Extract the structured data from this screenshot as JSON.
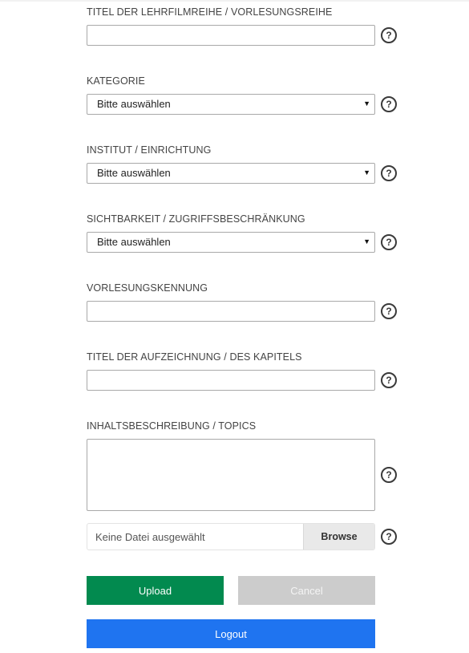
{
  "fields": {
    "series_title": {
      "label": "TITEL DER LEHRFILMREIHE / VORLESUNGSREIHE",
      "value": ""
    },
    "category": {
      "label": "KATEGORIE",
      "selected": "Bitte auswählen"
    },
    "institute": {
      "label": "INSTITUT / EINRICHTUNG",
      "selected": "Bitte auswählen"
    },
    "visibility": {
      "label": "SICHTBARKEIT / ZUGRIFFSBESCHRÄNKUNG",
      "selected": "Bitte auswählen"
    },
    "lecture_id": {
      "label": "VORLESUNGSKENNUNG",
      "value": ""
    },
    "recording_title": {
      "label": "TITEL DER AUFZEICHNUNG / DES KAPITELS",
      "value": ""
    },
    "description": {
      "label": "INHALTSBESCHREIBUNG / TOPICS",
      "value": ""
    }
  },
  "file": {
    "placeholder": "Keine Datei ausgewählt",
    "browse_label": "Browse"
  },
  "help_glyph": "?",
  "select_arrow": "▼",
  "buttons": {
    "upload": "Upload",
    "cancel": "Cancel",
    "logout": "Logout"
  },
  "colors": {
    "upload": "#028a4f",
    "cancel": "#cccccc",
    "logout": "#1f74f0"
  }
}
